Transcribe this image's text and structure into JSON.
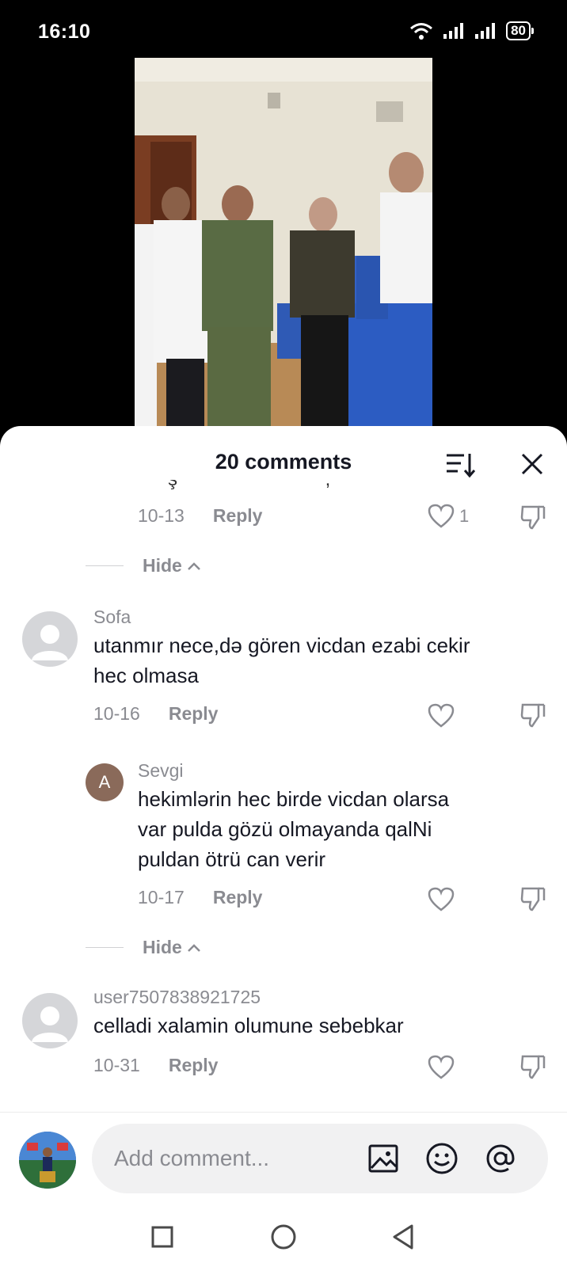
{
  "status_bar": {
    "time": "16:10",
    "battery": "80"
  },
  "sheet": {
    "title": "20 comments",
    "cut_text": "ş , g , ,"
  },
  "comments": [
    {
      "date": "10-13",
      "reply": "Reply",
      "likes": "1"
    },
    {
      "username": "Sofa",
      "text_line1": "utanmır nece,də gören vicdan ezabi cekir",
      "text_line2": "hec olmasa",
      "date": "10-16",
      "reply": "Reply"
    },
    {
      "username": "Sevgi",
      "avatar_letter": "A",
      "text_line1": "hekimlərin hec birde vicdan olarsa",
      "text_line2": "var pulda gözü olmayanda qalNi",
      "text_line3": "puldan ötrü can verir",
      "date": "10-17",
      "reply": "Reply"
    },
    {
      "username": "user7507838921725",
      "text_line1": "celladi xalamin olumune sebebkar",
      "date": "10-31",
      "reply": "Reply"
    }
  ],
  "hide": [
    {
      "label": "Hide"
    },
    {
      "label": "Hide"
    }
  ],
  "input": {
    "placeholder": "Add comment..."
  },
  "colors": {
    "accent_text": "#161823",
    "muted": "#8a8b91",
    "sheet_bg": "#ffffff"
  }
}
